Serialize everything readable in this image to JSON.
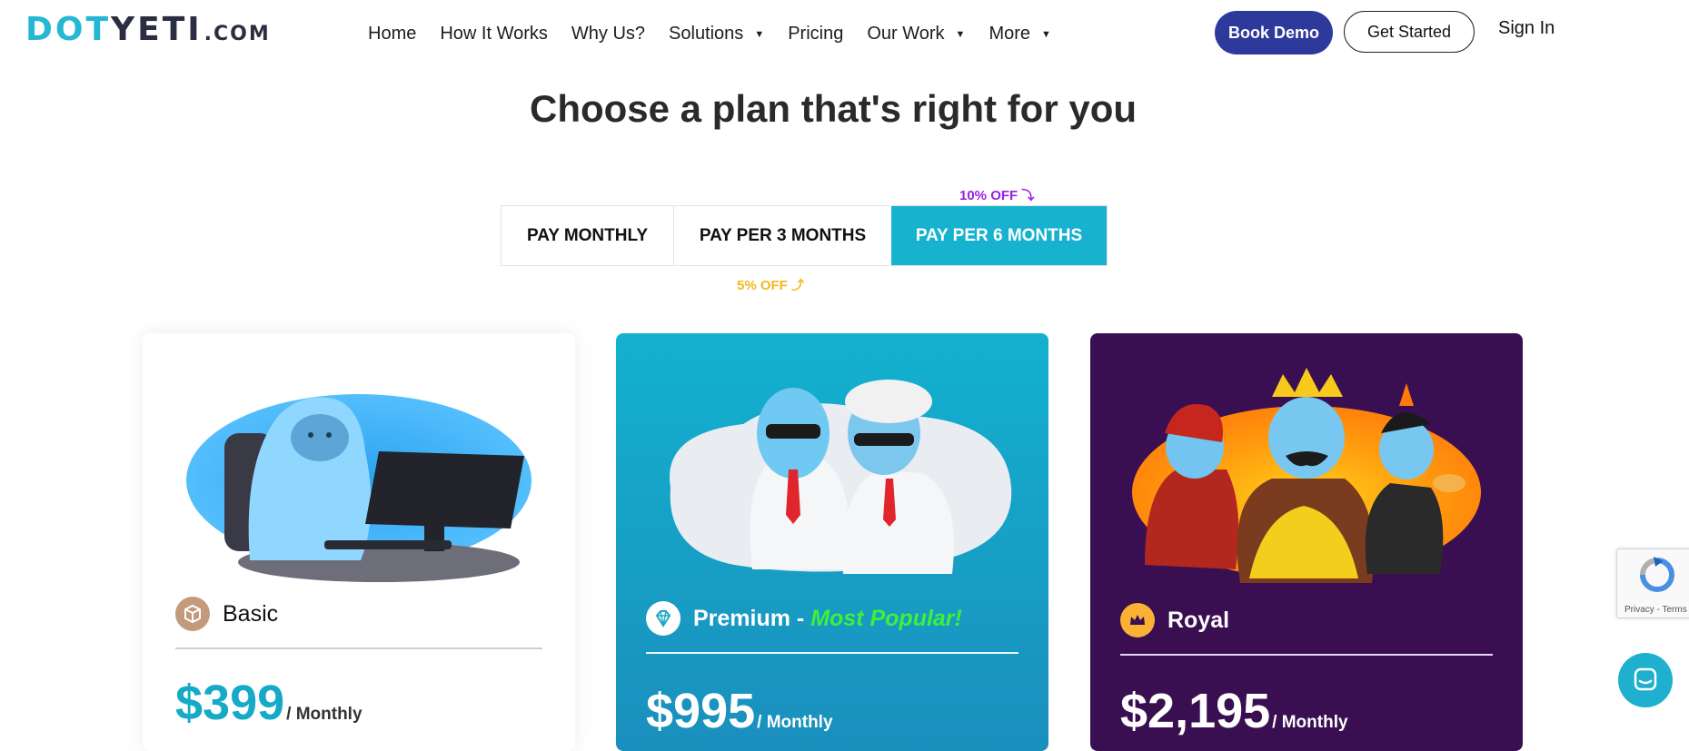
{
  "header": {
    "logo": {
      "main_first": "DOT",
      "main_second": "YETI",
      "tld": ".COM"
    },
    "nav": [
      {
        "label": "Home",
        "dropdown": false
      },
      {
        "label": "How It Works",
        "dropdown": false
      },
      {
        "label": "Why Us?",
        "dropdown": false
      },
      {
        "label": "Solutions",
        "dropdown": true
      },
      {
        "label": "Pricing",
        "dropdown": false
      },
      {
        "label": "Our Work",
        "dropdown": true
      },
      {
        "label": "More",
        "dropdown": true
      }
    ],
    "book_demo_label": "Book Demo",
    "get_started_label": "Get Started",
    "sign_in_label": "Sign In"
  },
  "page_title": "Choose a plan that's right for you",
  "billing": {
    "options": [
      "PAY MONTHLY",
      "PAY PER 3 MONTHS",
      "PAY PER 6 MONTHS"
    ],
    "selected": "PAY PER 6 MONTHS",
    "discount_6_months": "10% OFF",
    "discount_3_months": "5% OFF"
  },
  "plans": [
    {
      "name": "Basic",
      "price": "$399",
      "period": "/ Monthly",
      "icon": "box-icon"
    },
    {
      "name": "Premium - ",
      "highlight": "Most Popular!",
      "price": "$995",
      "period": "/ Monthly",
      "icon": "diamond-icon"
    },
    {
      "name": "Royal",
      "price": "$2,195",
      "period": "/ Monthly",
      "icon": "crown-icon"
    }
  ],
  "widgets": {
    "recaptcha_text": "Privacy - Terms"
  },
  "colors": {
    "brand_teal": "#17b2cf",
    "brand_navy": "#2e3a9b",
    "royal_purple": "#3a0f52",
    "popular_green": "#3ef03c",
    "discount_purple": "#9b1fe3",
    "discount_yellow": "#f1b91c"
  }
}
